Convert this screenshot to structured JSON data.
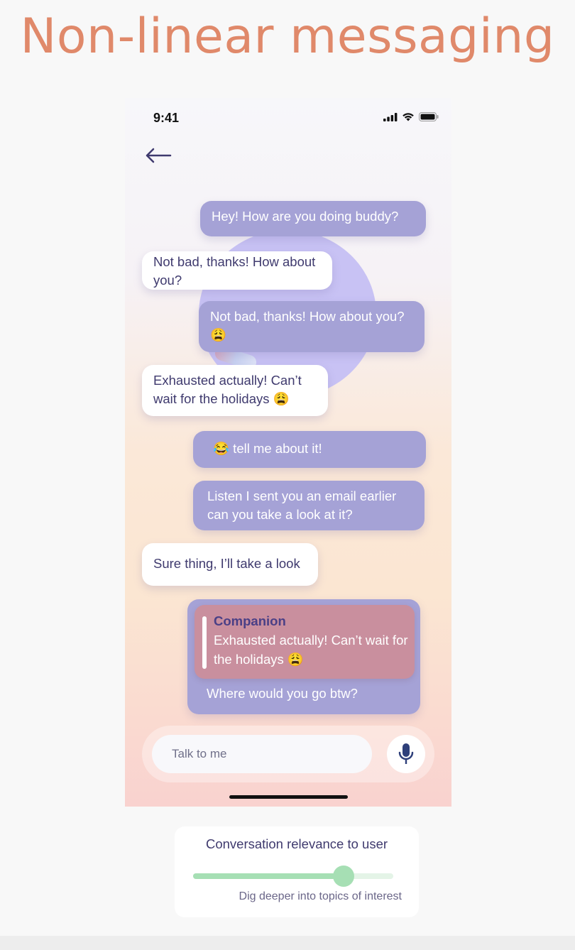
{
  "page": {
    "title": "Non-linear messaging"
  },
  "status_bar": {
    "time": "9:41",
    "icons": [
      "cellular-signal-icon",
      "wifi-icon",
      "battery-icon"
    ]
  },
  "nav": {
    "back_icon": "arrow-left-icon"
  },
  "messages": [
    {
      "side": "out",
      "text": "Hey! How are you doing buddy?"
    },
    {
      "side": "in",
      "text": "Not bad, thanks! How about you?"
    },
    {
      "side": "out",
      "text": "Not bad, thanks! How about you? 😩"
    },
    {
      "side": "in",
      "text": "Exhausted actually! Can’t wait for the holidays 😩"
    },
    {
      "side": "out",
      "text": "😂 tell me about it!"
    },
    {
      "side": "out",
      "text": "Listen I sent you an email earlier can you take a look at it?"
    },
    {
      "side": "in",
      "text": "Sure thing, I’ll take a look"
    }
  ],
  "reply_message": {
    "quote_author": "Companion",
    "quote_text": "Exhausted actually! Can’t wait for the holidays 😩",
    "text": "Where would you go btw?"
  },
  "composer": {
    "placeholder": "Talk to me",
    "mic_icon": "microphone-icon"
  },
  "relevance": {
    "title": "Conversation relevance to user",
    "caption": "Dig deeper into topics of interest",
    "level": 0.75
  },
  "colors": {
    "title": "#e0896a",
    "outgoing_bubble": "#a5a2d6",
    "incoming_bubble": "#ffffff",
    "quote_bubble": "#c98f9e",
    "slider": "#a6dfb4"
  }
}
